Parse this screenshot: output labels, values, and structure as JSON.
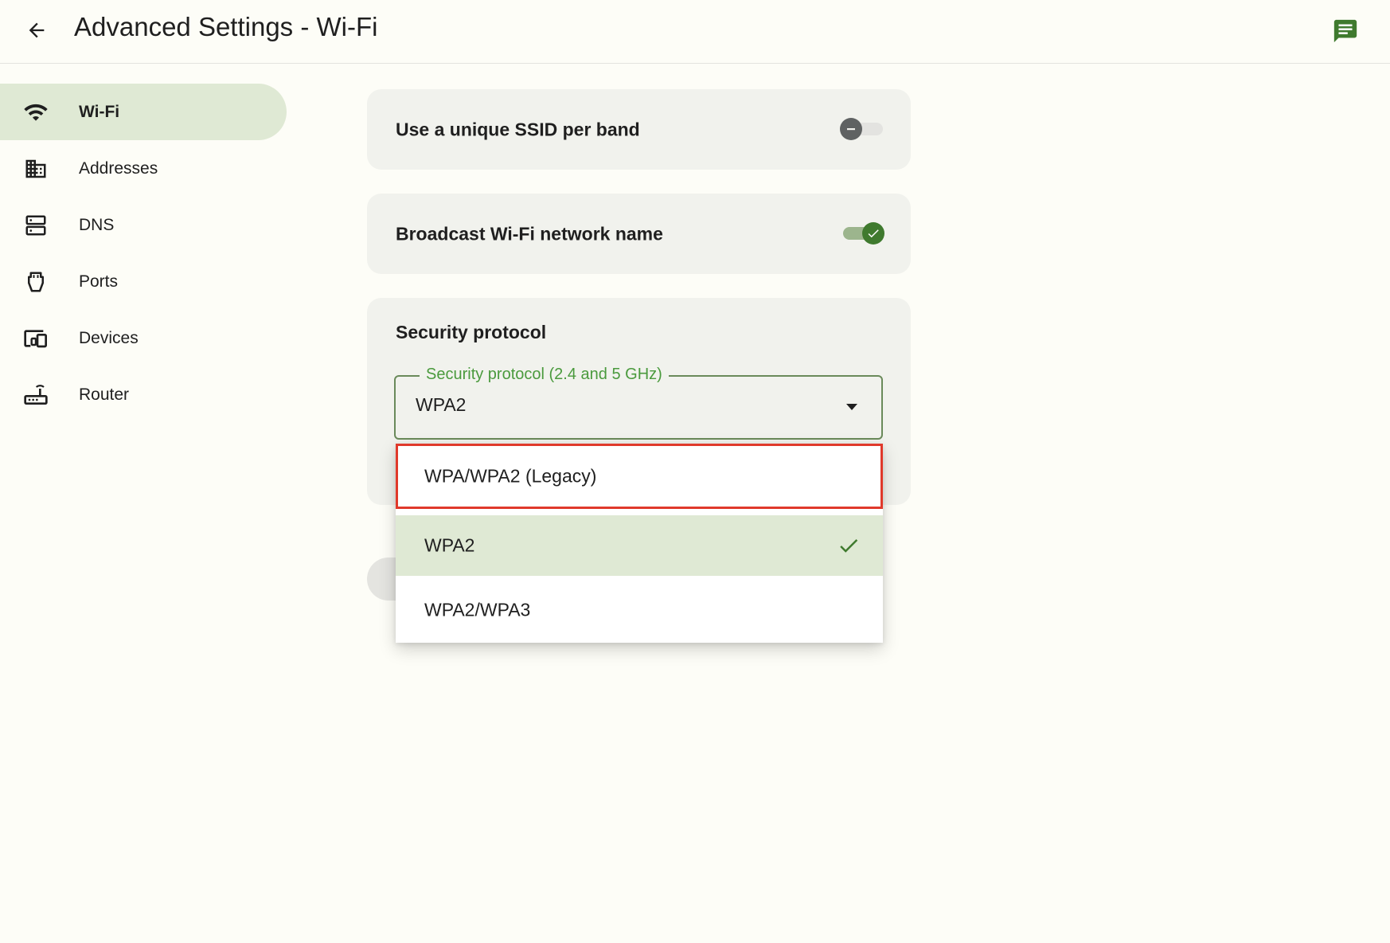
{
  "header": {
    "title": "Advanced Settings - Wi-Fi",
    "back_icon": "arrow-back-icon",
    "feedback_icon": "feedback-chat-icon"
  },
  "sidebar": {
    "items": [
      {
        "label": "Wi-Fi",
        "icon": "wifi-icon",
        "active": true
      },
      {
        "label": "Addresses",
        "icon": "building-icon",
        "active": false
      },
      {
        "label": "DNS",
        "icon": "dns-server-icon",
        "active": false
      },
      {
        "label": "Ports",
        "icon": "ethernet-port-icon",
        "active": false
      },
      {
        "label": "Devices",
        "icon": "devices-icon",
        "active": false
      },
      {
        "label": "Router",
        "icon": "router-icon",
        "active": false
      }
    ]
  },
  "settings": {
    "unique_ssid": {
      "label": "Use a unique SSID per band",
      "enabled": false
    },
    "broadcast": {
      "label": "Broadcast Wi-Fi network name",
      "enabled": true
    },
    "security": {
      "title": "Security protocol",
      "field_label": "Security protocol (2.4 and 5 GHz)",
      "value": "WPA2",
      "options": [
        {
          "label": "WPA/WPA2 (Legacy)",
          "selected": false,
          "highlighted": true
        },
        {
          "label": "WPA2",
          "selected": true,
          "highlighted": false
        },
        {
          "label": "WPA2/WPA3",
          "selected": false,
          "highlighted": false
        }
      ]
    }
  },
  "colors": {
    "accent": "#3f7a2e",
    "active_bg": "#dfe9d4",
    "card_bg": "#f1f2ed",
    "field_label": "#4a9a3d",
    "highlight": "#e0392b"
  }
}
